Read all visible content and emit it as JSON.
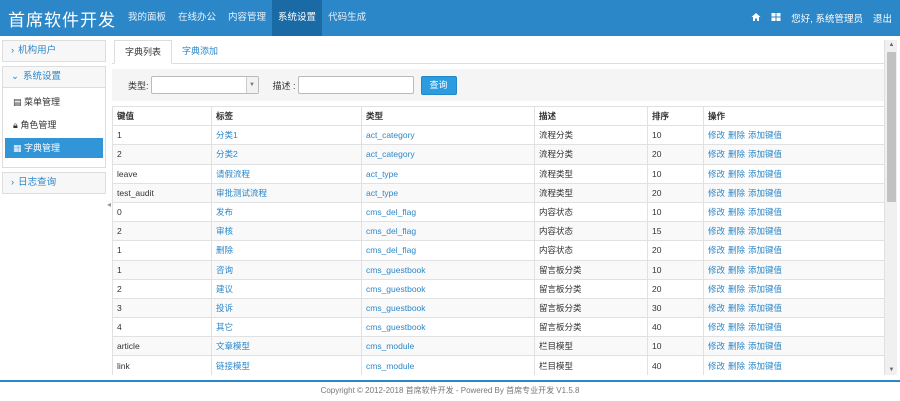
{
  "brand": "首席软件开发",
  "nav": [
    "我的面板",
    "在线办公",
    "内容管理",
    "系统设置",
    "代码生成"
  ],
  "nav_active_index": 3,
  "user": {
    "greeting": "您好, 系统管理员",
    "logout": "退出"
  },
  "sidebar": {
    "group_org": "机构用户",
    "group_system": "系统设置",
    "items": [
      "菜单管理",
      "角色管理",
      "字典管理"
    ],
    "group_log": "日志查询"
  },
  "tabs": [
    "字典列表",
    "字典添加"
  ],
  "search": {
    "type_label": "类型:",
    "desc_label": "描述 :",
    "query_button": "查询"
  },
  "table": {
    "columns": [
      "键值",
      "标签",
      "类型",
      "描述",
      "排序",
      "操作"
    ],
    "op_labels": [
      "修改",
      "删除",
      "添加键值"
    ],
    "rows": [
      [
        "1",
        "分类1",
        "act_category",
        "流程分类",
        "10"
      ],
      [
        "2",
        "分类2",
        "act_category",
        "流程分类",
        "20"
      ],
      [
        "leave",
        "请假流程",
        "act_type",
        "流程类型",
        "10"
      ],
      [
        "test_audit",
        "审批测试流程",
        "act_type",
        "流程类型",
        "20"
      ],
      [
        "0",
        "发布",
        "cms_del_flag",
        "内容状态",
        "10"
      ],
      [
        "2",
        "审核",
        "cms_del_flag",
        "内容状态",
        "15"
      ],
      [
        "1",
        "删除",
        "cms_del_flag",
        "内容状态",
        "20"
      ],
      [
        "1",
        "咨询",
        "cms_guestbook",
        "留言板分类",
        "10"
      ],
      [
        "2",
        "建议",
        "cms_guestbook",
        "留言板分类",
        "20"
      ],
      [
        "3",
        "投诉",
        "cms_guestbook",
        "留言板分类",
        "30"
      ],
      [
        "4",
        "其它",
        "cms_guestbook",
        "留言板分类",
        "40"
      ],
      [
        "article",
        "文章模型",
        "cms_module",
        "栏目模型",
        "10"
      ],
      [
        "link",
        "链接模型",
        "cms_module",
        "栏目模型",
        "40"
      ]
    ]
  },
  "footer": "Copyright © 2012-2018 首席软件开发 - Powered By 首席专业开发 V1.5.8",
  "colors": {
    "primary": "#2c87c8",
    "nav_active": "#1a6aa6",
    "button": "#2c9be0"
  }
}
